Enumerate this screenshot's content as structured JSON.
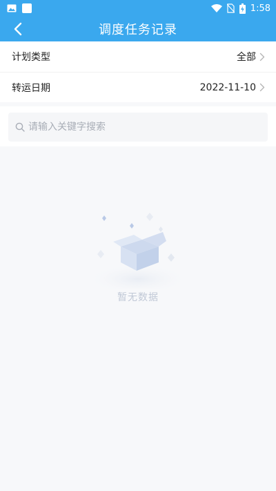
{
  "status_bar": {
    "time": "1:58",
    "icons": [
      "gallery-icon",
      "app-icon",
      "wifi-icon",
      "no-sim-icon",
      "battery-charging-icon"
    ]
  },
  "header": {
    "title": "调度任务记录",
    "back_icon": "back-arrow-icon"
  },
  "filters": {
    "plan_type": {
      "label": "计划类型",
      "value": "全部"
    },
    "transfer_date": {
      "label": "转运日期",
      "value": "2022-11-10"
    }
  },
  "search": {
    "placeholder": "请输入关键字搜索",
    "value": ""
  },
  "empty_state": {
    "text": "暂无数据",
    "icon": "empty-box-icon"
  },
  "colors": {
    "primary": "#3aa8ee",
    "background": "#f7f8fa",
    "empty_text": "#c0c8d6"
  }
}
